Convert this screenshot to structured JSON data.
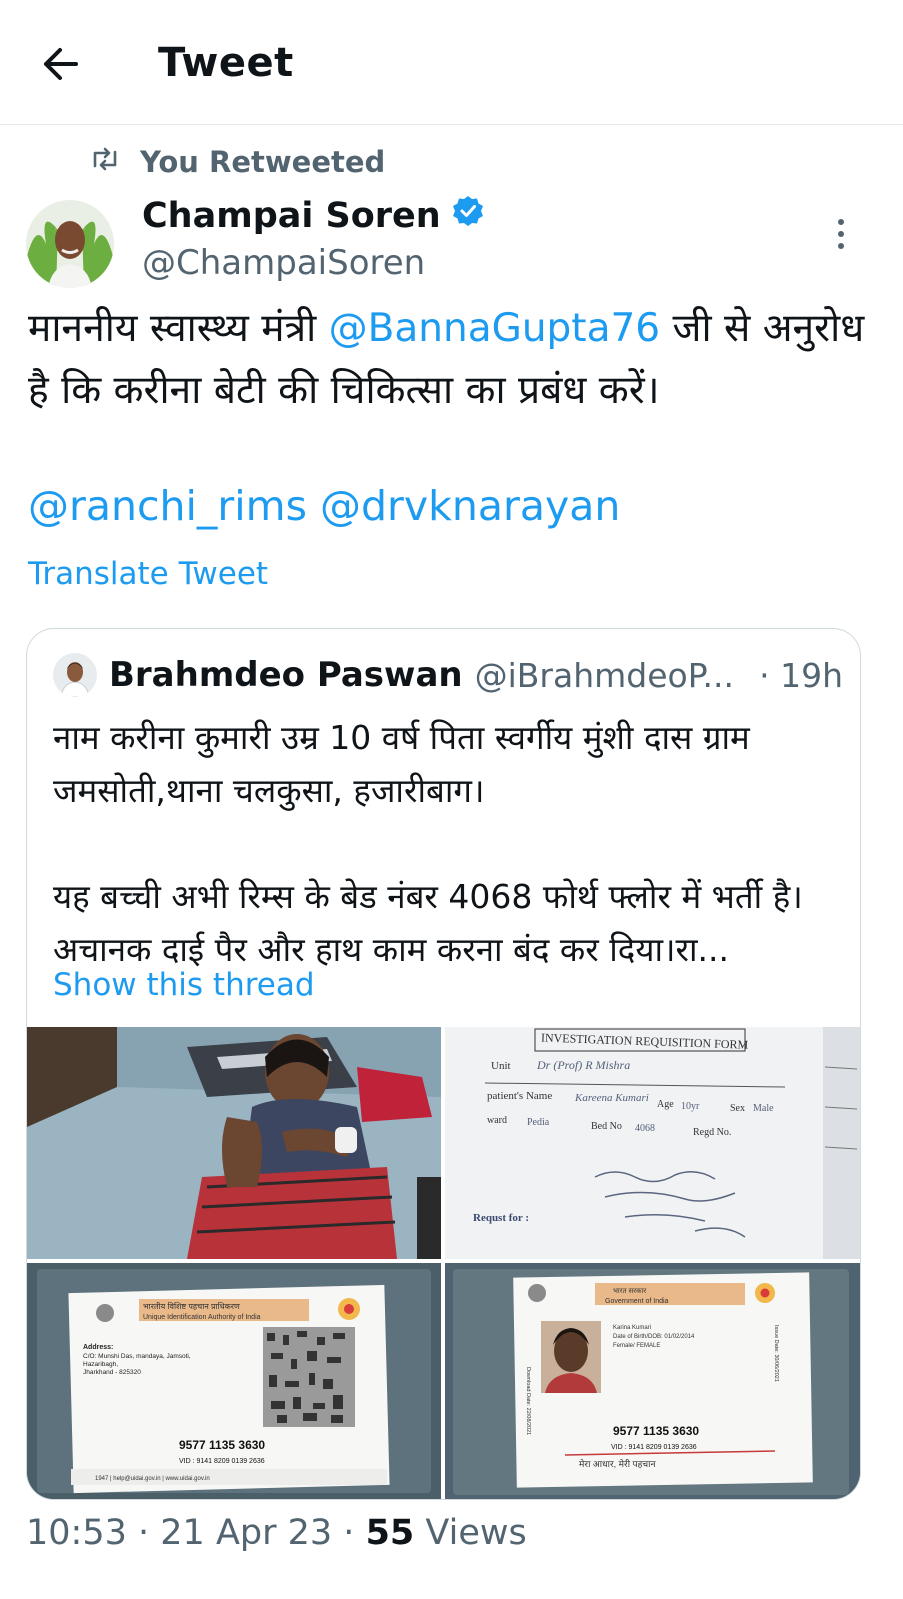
{
  "header": {
    "title": "Tweet"
  },
  "social_context": "You Retweeted",
  "tweet": {
    "author_name": "Champai Soren",
    "author_handle": "@ChampaiSoren",
    "text_prefix": "माननीय स्वास्थ्य मंत्री ",
    "text_mention": "@BannaGupta76",
    "text_suffix": " जी से अनुरोध है कि करीना बेटी की चिकित्सा का प्रबंध करें।",
    "mentions_line": "@ranchi_rims @drvknarayan",
    "translate": "Translate Tweet"
  },
  "quoted": {
    "author_name": "Brahmdeo Paswan",
    "author_handle": "@iBrahmdeoP...",
    "time": "· 19h",
    "line1": "नाम करीना कुमारी उम्र 10 वर्ष पिता स्वर्गीय मुंशी दास ग्राम जमसोती,थाना चलकुसा, हजारीबाग।",
    "line2": "यह बच्ची अभी रिम्स के बेड नंबर 4068 फोर्थ फ्लोर में भर्ती है।अचानक दाई पैर और हाथ काम करना बंद कर दिया।रा...",
    "show_thread": "Show this thread",
    "photos": {
      "form": {
        "heading": "INVESTIGATION REQUISITION FORM",
        "unit": "Unit",
        "unit_value": "Dr (Prof) R Mishra",
        "patient_name": "patient's Name",
        "patient_value": "Kareena Kumari",
        "age": "Age",
        "age_value": "10yr",
        "sex": "Sex",
        "sex_value": "Male",
        "ward": "ward",
        "ward_value": "Pedia",
        "bed_no": "Bed No",
        "bed_value": "4068",
        "regd_no": "Regd No.",
        "request_for": "Requst for :"
      },
      "aadhaar_back": {
        "authority_hi": "भारतीय विशिष्ट पहचान प्राधिकरण",
        "authority_en": "Unique Identification Authority of India",
        "address_label": "Address:",
        "address_lines": [
          "C/O: Munshi Das, mandaya, Jamsoti,",
          "Hazaribagh,",
          "Jharkhand - 825320"
        ],
        "number": "9577 1135 3630",
        "vid": "VID : 9141 8209 0139 2636",
        "footer": "1947  |  help@uidai.gov.in  |  www.uidai.gov.in"
      },
      "aadhaar_front": {
        "gov_hi": "भारत सरकार",
        "gov_en": "Government of India",
        "name_line": "Karina Kumari",
        "dob_line": "Date of Birth/DOB: 01/02/2014",
        "gender_line": "Female/ FEMALE",
        "download_date": "Download Date: 22/08/2021",
        "issue_date": "Issue Date: 30/06/2021",
        "number": "9577 1135 3630",
        "vid": "VID : 9141 8209 0139 2636",
        "slogan": "मेरा आधार, मेरी पहचान"
      }
    }
  },
  "footer": {
    "time": "10:53",
    "date": "21 Apr 23",
    "views_count": "55",
    "views_label": "Views"
  },
  "colors": {
    "accent": "#1d9bf0",
    "muted": "#536471",
    "text": "#0f1419",
    "border": "#cfd9de"
  },
  "icons": [
    "back-arrow-icon",
    "retweet-icon",
    "verified-badge-icon",
    "more-options-icon"
  ]
}
